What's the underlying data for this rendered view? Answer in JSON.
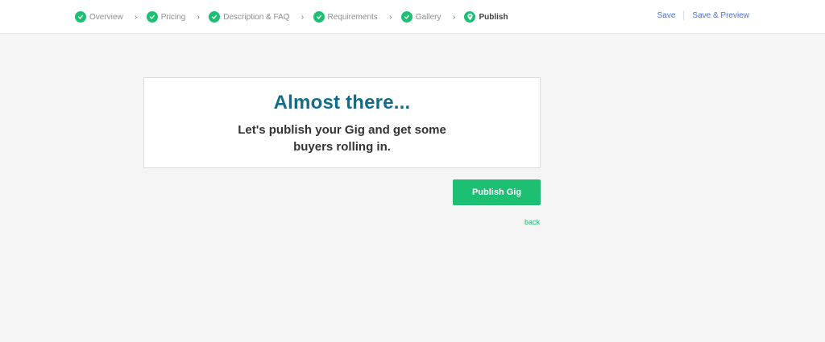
{
  "steps": [
    {
      "label": "Overview",
      "status": "complete"
    },
    {
      "label": "Pricing",
      "status": "complete"
    },
    {
      "label": "Description & FAQ",
      "status": "complete"
    },
    {
      "label": "Requirements",
      "status": "complete"
    },
    {
      "label": "Gallery",
      "status": "complete"
    },
    {
      "label": "Publish",
      "status": "current"
    }
  ],
  "separator": "›",
  "top_actions": {
    "save": "Save",
    "save_preview": "Save & Preview"
  },
  "card": {
    "title": "Almost there...",
    "subtitle": "Let's publish your Gig and get some buyers rolling in."
  },
  "publish_button": "Publish Gig",
  "back_link": "back",
  "colors": {
    "accent": "#1dbf73",
    "title": "#146c8a",
    "link": "#446ee7"
  },
  "icons": {
    "complete": "check-icon",
    "current": "map-pin-icon",
    "separator": "chevron-right-icon"
  }
}
